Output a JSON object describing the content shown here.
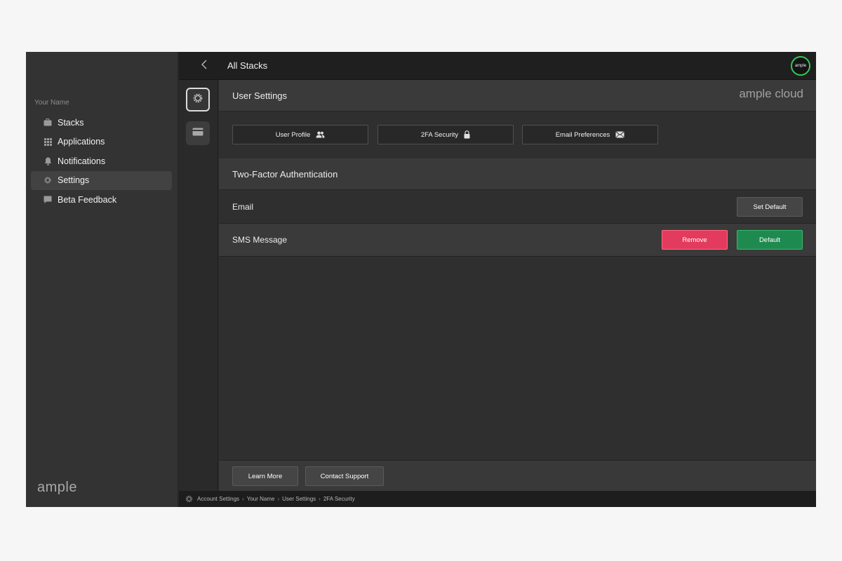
{
  "colors": {
    "accent_green": "#1f8a4f",
    "danger_red": "#e23b5d",
    "avatar_ring": "#34c759"
  },
  "sidebar": {
    "user_name": "Your Name",
    "items": [
      {
        "label": "Stacks",
        "icon": "briefcase-icon",
        "active": false
      },
      {
        "label": "Applications",
        "icon": "grid-icon",
        "active": false
      },
      {
        "label": "Notifications",
        "icon": "bell-icon",
        "active": false
      },
      {
        "label": "Settings",
        "icon": "gear-icon",
        "active": true
      },
      {
        "label": "Beta Feedback",
        "icon": "chat-bubble-icon",
        "active": false
      }
    ],
    "logo": "ample"
  },
  "topbar": {
    "title": "All Stacks",
    "avatar_text": "ample"
  },
  "rail": {
    "items": [
      {
        "icon": "gear-icon",
        "active": true
      },
      {
        "icon": "credit-card-icon",
        "active": false
      }
    ]
  },
  "main": {
    "header_title": "User Settings",
    "brand": "ample cloud",
    "tabs": [
      {
        "label": "User Profile",
        "icon": "users-icon"
      },
      {
        "label": "2FA Security",
        "icon": "lock-icon"
      },
      {
        "label": "Email Preferences",
        "icon": "envelope-icon"
      }
    ],
    "section_title": "Two-Factor Authentication",
    "methods": [
      {
        "label": "Email",
        "set_default_label": "Set Default"
      },
      {
        "label": "SMS Message",
        "remove_label": "Remove",
        "default_label": "Default"
      }
    ],
    "footer": {
      "learn_more": "Learn More",
      "contact_support": "Contact Support"
    }
  },
  "statusbar": {
    "breadcrumb": [
      "Account Settings",
      "Your Name",
      "User Settings",
      "2FA Security"
    ],
    "separator": "›"
  }
}
